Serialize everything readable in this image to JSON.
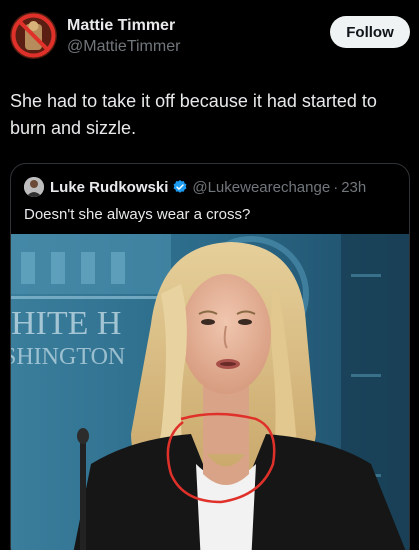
{
  "post": {
    "author_name": "Mattie Timmer",
    "author_handle": "@MattieTimmer",
    "follow_label": "Follow",
    "text": "She had to take it off because it had started to burn and sizzle."
  },
  "quote": {
    "author_name": "Luke Rudkowski",
    "author_handle": "@Lukewearechange",
    "separator": "·",
    "time": "23h",
    "text": "Doesn't she always wear a cross?"
  },
  "media": {
    "backdrop_line1": "HITE H",
    "backdrop_line2": "SHINGTON"
  },
  "colors": {
    "accent_verified": "#1d9bf0",
    "circle_annotation": "#e0302a"
  },
  "icons": {
    "verified": "verified-badge-icon",
    "avatar_mark": "prohibited-sign-icon"
  }
}
